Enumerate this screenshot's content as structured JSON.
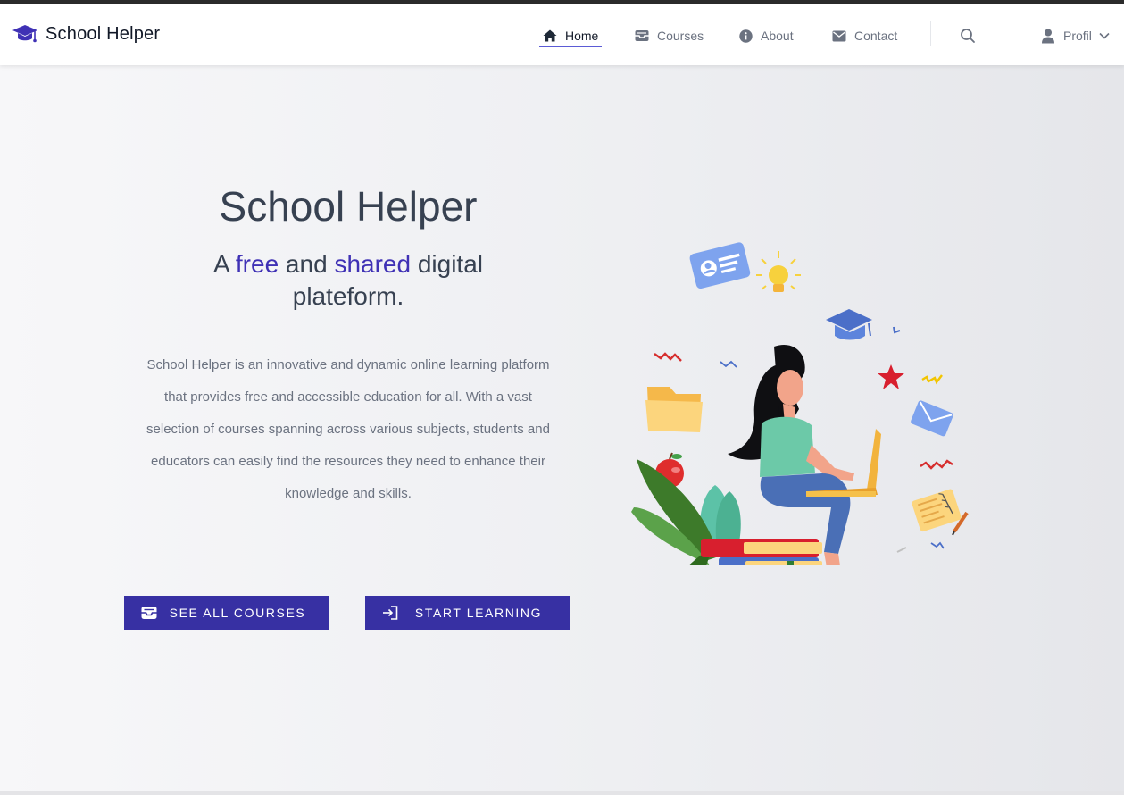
{
  "brand": {
    "name": "School Helper",
    "icon": "graduation-cap-icon"
  },
  "nav": {
    "items": [
      {
        "label": "Home",
        "icon": "home-icon",
        "active": true
      },
      {
        "label": "Courses",
        "icon": "inbox-icon",
        "active": false
      },
      {
        "label": "About",
        "icon": "info-icon",
        "active": false
      },
      {
        "label": "Contact",
        "icon": "envelope-icon",
        "active": false
      }
    ],
    "search_icon": "search-icon",
    "profile": {
      "label": "Profil",
      "icon": "user-icon",
      "caret": "chevron-down-icon"
    }
  },
  "hero": {
    "title": "School Helper",
    "subtitle": {
      "prefix": "A ",
      "word1": "free",
      "middle": " and ",
      "word2": "shared",
      "suffix": " digital plateform."
    },
    "description": "School Helper is an innovative and dynamic online learning platform that provides free and accessible education for all. With a vast selection of courses spanning across various subjects, students and educators can easily find the resources they need to enhance their knowledge and skills.",
    "buttons": [
      {
        "label": "SEE ALL COURSES",
        "icon": "inbox-icon"
      },
      {
        "label": "START LEARNING",
        "icon": "sign-in-icon"
      }
    ]
  },
  "colors": {
    "accent": "#3730a3",
    "highlight": "#3f31b5",
    "nav_underline": "#5b5bd6"
  }
}
